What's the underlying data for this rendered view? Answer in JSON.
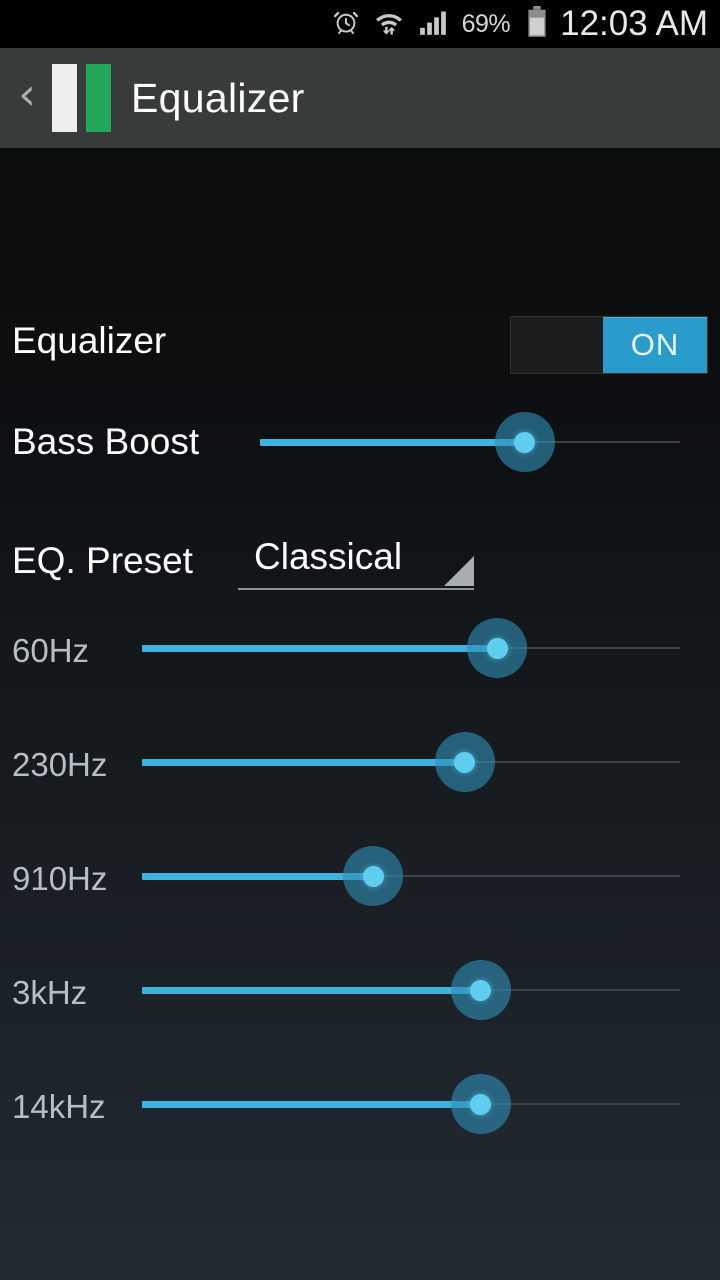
{
  "status_bar": {
    "icons": [
      "alarm-icon",
      "wifi-icon",
      "signal-icon"
    ],
    "battery_percent": "69%",
    "battery_icon": "battery-icon",
    "clock": "12:03 AM"
  },
  "action_bar": {
    "back_icon": "back-chevron-icon",
    "logo_icon": "equalizer-bars-logo",
    "logo_colors": {
      "bar_light": "#eceeed",
      "bar_green": "#22a75c"
    },
    "title": "Equalizer"
  },
  "settings": {
    "equalizer": {
      "label": "Equalizer",
      "toggle_state": "ON",
      "toggle_on_color": "#2a9ccb"
    },
    "bass_boost": {
      "label": "Bass Boost",
      "value_percent": 63
    },
    "eq_preset": {
      "label": "EQ. Preset",
      "selected": "Classical",
      "dropdown_icon": "spinner-triangle-icon"
    }
  },
  "bands": [
    {
      "label": "60Hz",
      "value_percent": 66
    },
    {
      "label": "230Hz",
      "value_percent": 60
    },
    {
      "label": "910Hz",
      "value_percent": 43
    },
    {
      "label": "3kHz",
      "value_percent": 63
    },
    {
      "label": "14kHz",
      "value_percent": 63
    }
  ],
  "theme": {
    "accent": "#3fb3e0",
    "background_top": "#0a0c0d",
    "background_bottom": "#232a32",
    "action_bar": "#373b3a"
  }
}
